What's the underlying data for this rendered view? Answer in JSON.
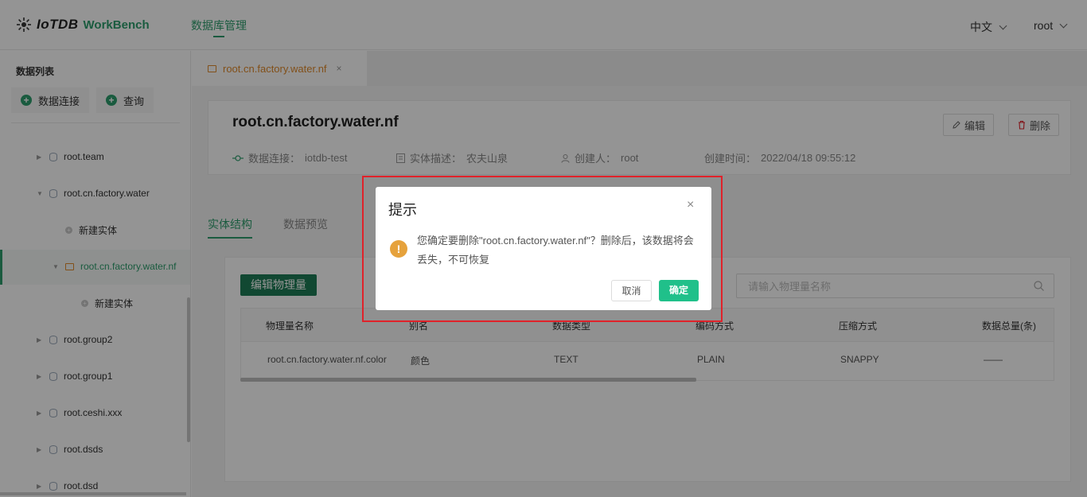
{
  "header": {
    "logo_mark": "IoTDB",
    "logo_text": "WorkBench",
    "nav_item": "数据库管理",
    "language": "中文",
    "user": "root"
  },
  "sidebar": {
    "title": "数据列表",
    "btn_connect": "数据连接",
    "btn_query": "查询",
    "tree": [
      {
        "label": "root.team"
      },
      {
        "label": "root.cn.factory.water"
      },
      {
        "label": "新建实体"
      },
      {
        "label": "root.cn.factory.water.nf"
      },
      {
        "label": "新建实体"
      },
      {
        "label": "root.group2"
      },
      {
        "label": "root.group1"
      },
      {
        "label": "root.ceshi.xxx"
      },
      {
        "label": "root.dsds"
      },
      {
        "label": "root.dsd"
      }
    ]
  },
  "tab": {
    "label": "root.cn.factory.water.nf",
    "close": "×"
  },
  "entity": {
    "title": "root.cn.factory.water.nf",
    "edit_label": "编辑",
    "delete_label": "删除",
    "connection_label": "数据连接：",
    "connection_value": "iotdb-test",
    "desc_label": "实体描述：",
    "desc_value": "农夫山泉",
    "creator_label": "创建人：",
    "creator_value": "root",
    "created_label": "创建时间：",
    "created_value": "2022/04/18 09:55:12"
  },
  "content_tabs": [
    "实体结构",
    "数据预览"
  ],
  "table": {
    "edit_button": "编辑物理量",
    "search_placeholder": "请输入物理量名称",
    "columns": [
      "物理量名称",
      "别名",
      "数据类型",
      "编码方式",
      "压缩方式",
      "数据总量(条)"
    ],
    "rows": [
      [
        "root.cn.factory.water.nf.color",
        "颜色",
        "TEXT",
        "PLAIN",
        "SNAPPY",
        "——"
      ]
    ]
  },
  "dialog": {
    "title": "提示",
    "close": "×",
    "message": "您确定要删除\"root.cn.factory.water.nf\"？删除后，该数据将会丢失，不可恢复",
    "cancel": "取消",
    "confirm": "确定",
    "warn_symbol": "!"
  },
  "colors": {
    "brand": "#2e9e6d",
    "accent_orange": "#e08a2c",
    "confirm": "#20c08a",
    "highlight": "#e0222a"
  },
  "icons": [
    "tree-icon",
    "search-icon",
    "pencil-icon",
    "trash-icon",
    "link-icon",
    "doc-icon",
    "user-icon",
    "warning-icon",
    "close-icon",
    "database-icon",
    "briefcase-icon"
  ]
}
